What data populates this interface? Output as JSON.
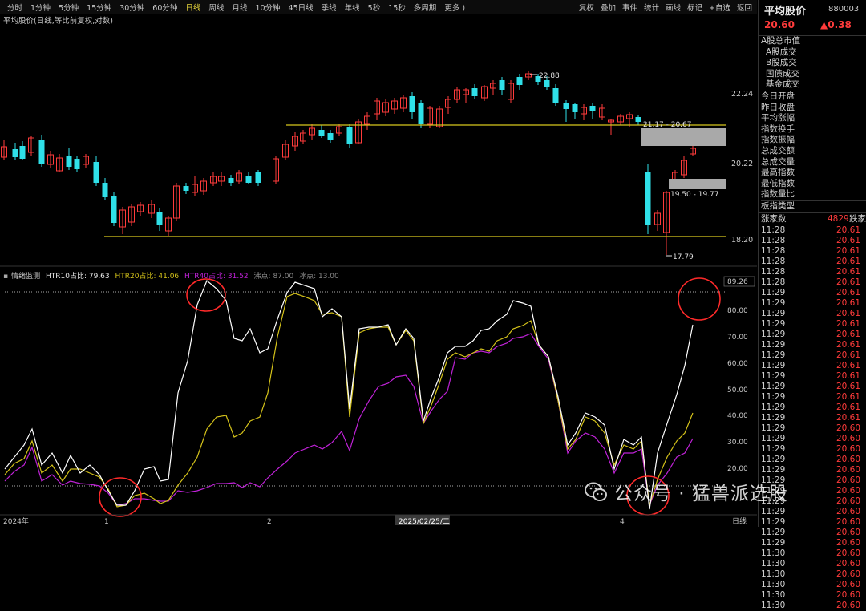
{
  "toolbar": {
    "tabs": [
      "分时",
      "1分钟",
      "5分钟",
      "15分钟",
      "30分钟",
      "60分钟",
      "日线",
      "周线",
      "月线",
      "10分钟",
      "45日线",
      "季线",
      "年线",
      "5秒",
      "15秒",
      "多周期",
      "更多 )"
    ],
    "active_tab": "日线",
    "tools": [
      "复权",
      "叠加",
      "事件",
      "统计",
      "画线",
      "标记",
      "+自选",
      "返回"
    ]
  },
  "chart_title": "平均股价(日线,等比前复权,对数)",
  "price_axis": [
    "22.24",
    "20.22",
    "18.20"
  ],
  "annotations": {
    "high": "22.88",
    "low": "17.79",
    "upper_range": "21.17 - 20.67",
    "lower_range": "19.50 - 19.77"
  },
  "indicator": {
    "name": "情绪监测",
    "htr10": "HTR10占比: 79.63",
    "htr20": "HTR20占比: 41.06",
    "htr40": "HTR40占比: 31.52",
    "hot": "沸点: 87.00",
    "ice": "冰点: 13.00",
    "axis": [
      "89.26",
      "80.00",
      "70.00",
      "60.00",
      "50.00",
      "40.00",
      "30.00",
      "20.00"
    ],
    "colors": {
      "htr10": "#ffffff",
      "htr20": "#d4c21a",
      "htr40": "#c022d8"
    }
  },
  "date_axis": [
    "2024年",
    "1",
    "2",
    "2025/02/25/二",
    "4",
    "日线"
  ],
  "sidebar": {
    "name": "平均股价",
    "code": "880003",
    "price": "20.60",
    "change": "▲0.38",
    "items": [
      "A股总市值",
      "A股成交",
      "B股成交",
      "国债成交",
      "基金成交",
      "今日开盘",
      "昨日收盘",
      "平均涨幅",
      "指数换手",
      "指数振幅",
      "总成交额",
      "总成交量",
      "最高指数",
      "最低指数",
      "指数量比",
      "板指类型"
    ],
    "updown": {
      "label": "涨家数",
      "value": "4829",
      "right": "跌家"
    },
    "ticks": [
      [
        "11:28",
        "20.61"
      ],
      [
        "11:28",
        "20.61"
      ],
      [
        "11:28",
        "20.61"
      ],
      [
        "11:28",
        "20.61"
      ],
      [
        "11:28",
        "20.61"
      ],
      [
        "11:28",
        "20.61"
      ],
      [
        "11:29",
        "20.61"
      ],
      [
        "11:29",
        "20.61"
      ],
      [
        "11:29",
        "20.61"
      ],
      [
        "11:29",
        "20.61"
      ],
      [
        "11:29",
        "20.61"
      ],
      [
        "11:29",
        "20.61"
      ],
      [
        "11:29",
        "20.61"
      ],
      [
        "11:29",
        "20.61"
      ],
      [
        "11:29",
        "20.61"
      ],
      [
        "11:29",
        "20.61"
      ],
      [
        "11:29",
        "20.61"
      ],
      [
        "11:29",
        "20.61"
      ],
      [
        "11:29",
        "20.61"
      ],
      [
        "11:29",
        "20.60"
      ],
      [
        "11:29",
        "20.60"
      ],
      [
        "11:29",
        "20.60"
      ],
      [
        "11:29",
        "20.60"
      ],
      [
        "11:29",
        "20.60"
      ],
      [
        "11:29",
        "20.60"
      ],
      [
        "11:29",
        "20.60"
      ],
      [
        "11:29",
        "20.60"
      ],
      [
        "11:29",
        "20.60"
      ],
      [
        "11:29",
        "20.60"
      ],
      [
        "11:29",
        "20.60"
      ],
      [
        "11:29",
        "20.60"
      ],
      [
        "11:30",
        "20.60"
      ],
      [
        "11:30",
        "20.60"
      ],
      [
        "11:30",
        "20.60"
      ],
      [
        "11:30",
        "20.60"
      ],
      [
        "11:30",
        "20.60"
      ],
      [
        "11:30",
        "20.60"
      ]
    ]
  },
  "watermark": "公众号 · 猛兽派选股"
}
